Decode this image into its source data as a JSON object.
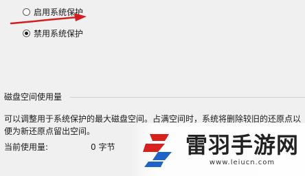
{
  "protection": {
    "enable_label": "启用系统保护",
    "disable_label": "禁用系统保护",
    "selected": "disable"
  },
  "disk_usage": {
    "section_title": "磁盘空间使用量",
    "description": "可以调整用于系统保护的最大磁盘空间。占满空间时，系统将删除较旧的还原点以便为新还原点留出空间。",
    "current_usage_label": "当前使用量:",
    "current_usage_value": "0 字节"
  },
  "watermark": {
    "title": "雷羽手游网",
    "url": "www.leiucn.com",
    "logo_icon": "lightning-s-logo-icon"
  },
  "colors": {
    "arrow": "#d21e1e",
    "logo_red": "#d8211c",
    "logo_blue": "#1e63c8"
  }
}
